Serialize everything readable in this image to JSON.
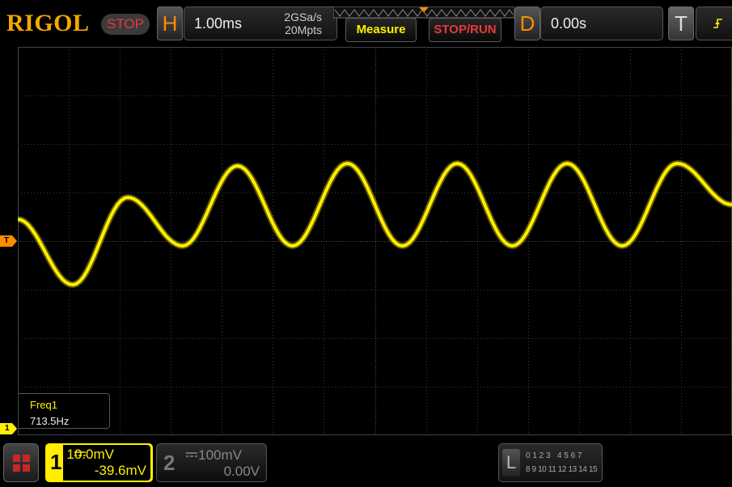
{
  "brand": {
    "logo": "RIGOL",
    "status": "STOP"
  },
  "horizontal": {
    "letter": "H",
    "timebase": "1.00ms",
    "sample_rate": "2GSa/s",
    "memory_depth": "20Mpts"
  },
  "buttons": {
    "measure": "Measure",
    "stop_run": "STOP/RUN"
  },
  "delay": {
    "letter": "D",
    "value": "0.00s"
  },
  "trigger": {
    "letter": "T"
  },
  "markers": {
    "trigger_top": "T",
    "trigger_left": "T",
    "ch1_ground": "1"
  },
  "measurement": {
    "label": "Freq1",
    "value": "713.5Hz"
  },
  "channel1": {
    "number": "1",
    "scale": "10.0mV",
    "offset": "-39.6mV"
  },
  "channel2": {
    "number": "2",
    "scale": "100mV",
    "offset": "0.00V"
  },
  "logic": {
    "letter": "L",
    "row1": "0 1 2 3   4 5 6 7",
    "row2": "8 9 10 11 12 13 14 15"
  },
  "colors": {
    "ch1": "#ffee00",
    "trigger": "#ff8c00",
    "logo": "#f2a900",
    "stop": "#e83a3a",
    "grid": "#3a3a3a"
  },
  "icons": {
    "menu": "grid-menu-icon",
    "trigger_edge": "rising-edge-icon",
    "coupling": "dc-coupling-icon"
  },
  "chart_data": {
    "type": "line",
    "series": [
      {
        "values": [
          0.45,
          -0.9,
          0.9,
          -0.1,
          1.55,
          -0.1,
          1.6,
          -0.1,
          1.6,
          -0.1,
          1.6,
          -0.1,
          1.6,
          0.75
        ]
      }
    ]
  }
}
